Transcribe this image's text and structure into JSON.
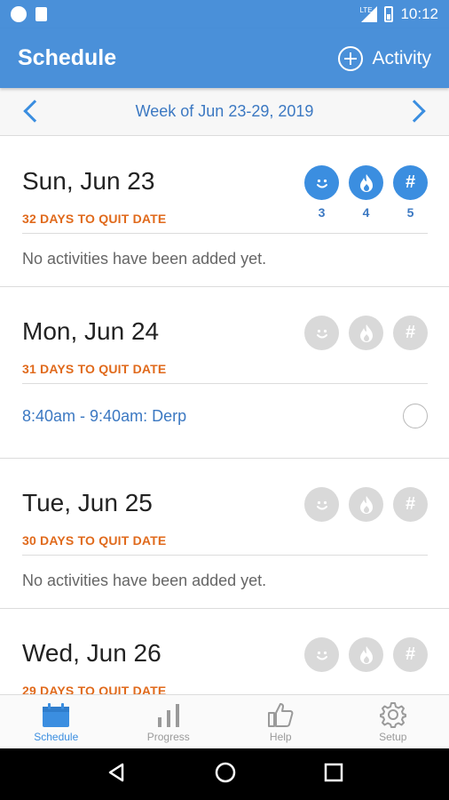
{
  "status_bar": {
    "time": "10:12",
    "network": "LTE"
  },
  "app_bar": {
    "title": "Schedule",
    "add_activity_label": "Activity"
  },
  "week_nav": {
    "label": "Week of Jun 23-29, 2019"
  },
  "days": [
    {
      "date": "Sun, Jun 23",
      "quit": "32 DAYS TO QUIT DATE",
      "note": "No activities have been added yet.",
      "trackers": [
        {
          "icon": "smiley-icon",
          "count": "3",
          "active": true
        },
        {
          "icon": "flame-icon",
          "count": "4",
          "active": true
        },
        {
          "icon": "hash-icon",
          "count": "5",
          "active": true
        }
      ]
    },
    {
      "date": "Mon, Jun 24",
      "quit": "31 DAYS TO QUIT DATE",
      "activity": "8:40am - 9:40am: Derp",
      "trackers": [
        {
          "icon": "smiley-icon",
          "active": false
        },
        {
          "icon": "flame-icon",
          "active": false
        },
        {
          "icon": "hash-icon",
          "active": false
        }
      ]
    },
    {
      "date": "Tue, Jun 25",
      "quit": "30 DAYS TO QUIT DATE",
      "note": "No activities have been added yet.",
      "trackers": [
        {
          "icon": "smiley-icon",
          "active": false
        },
        {
          "icon": "flame-icon",
          "active": false
        },
        {
          "icon": "hash-icon",
          "active": false
        }
      ]
    },
    {
      "date": "Wed, Jun 26",
      "quit": "29 DAYS TO QUIT DATE",
      "trackers": [
        {
          "icon": "smiley-icon",
          "active": false
        },
        {
          "icon": "flame-icon",
          "active": false
        },
        {
          "icon": "hash-icon",
          "active": false
        }
      ]
    }
  ],
  "bottom_nav": {
    "items": [
      {
        "label": "Schedule",
        "icon": "calendar-icon",
        "active": true
      },
      {
        "label": "Progress",
        "icon": "bar-chart-icon",
        "active": false
      },
      {
        "label": "Help",
        "icon": "thumbs-up-icon",
        "active": false
      },
      {
        "label": "Setup",
        "icon": "gear-icon",
        "active": false
      }
    ]
  },
  "colors": {
    "primary": "#4a90d9",
    "accent_blue": "#3b8ee0",
    "quit_orange": "#e06a1c",
    "inactive_gray": "#d9d9d9"
  }
}
